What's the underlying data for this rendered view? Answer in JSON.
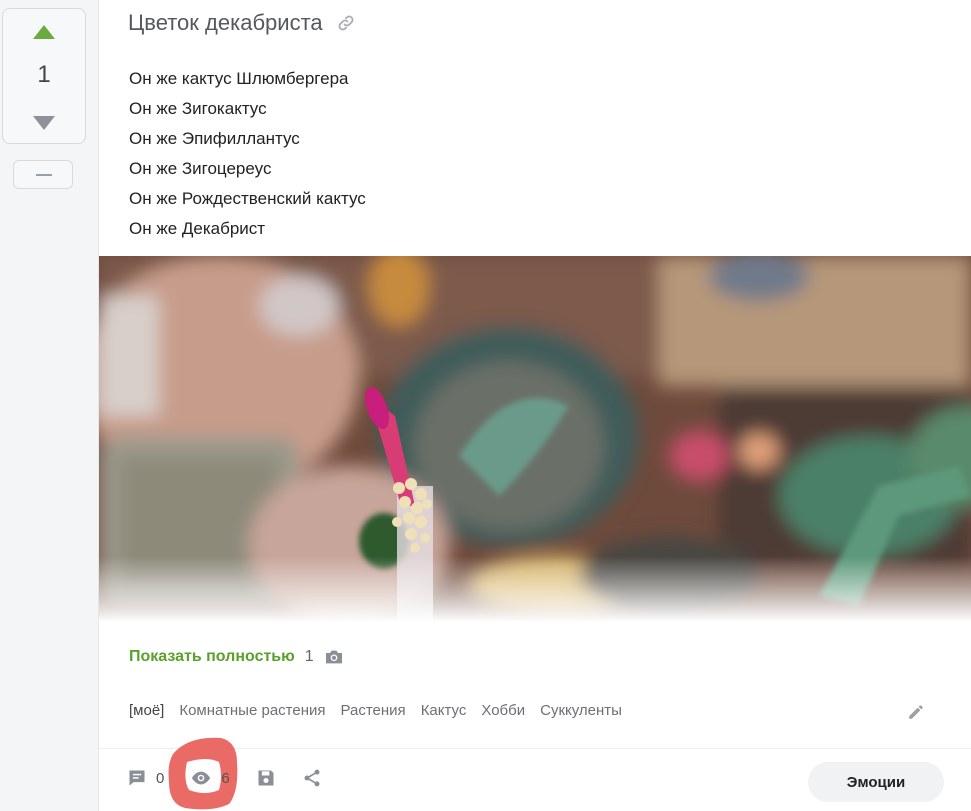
{
  "vote": {
    "count": "1"
  },
  "post": {
    "title": "Цветок декабриста",
    "lines": [
      "Он же кактус Шлюмбергера",
      "Он же Зигокактус",
      "Он же Эпифиллантус",
      "Он же Зигоцереус",
      "Он же Рождественский кактус",
      "Он же Декабрист"
    ],
    "show_more_label": "Показать полностью",
    "photo_count": "1"
  },
  "tags": [
    "[моё]",
    "Комнатные растения",
    "Растения",
    "Кактус",
    "Хобби",
    "Суккуленты"
  ],
  "footer": {
    "comments_count": "0",
    "views_count": "6",
    "emotions_label": "Эмоции"
  },
  "colors": {
    "accent_green": "#5aa02c",
    "vote_up": "#6aab3f",
    "highlight_red": "#e85a55"
  },
  "icons": [
    "chevron-up-icon",
    "chevron-down-icon",
    "link-icon",
    "camera-icon",
    "pencil-icon",
    "comment-icon",
    "eye-icon",
    "save-icon",
    "share-icon"
  ]
}
